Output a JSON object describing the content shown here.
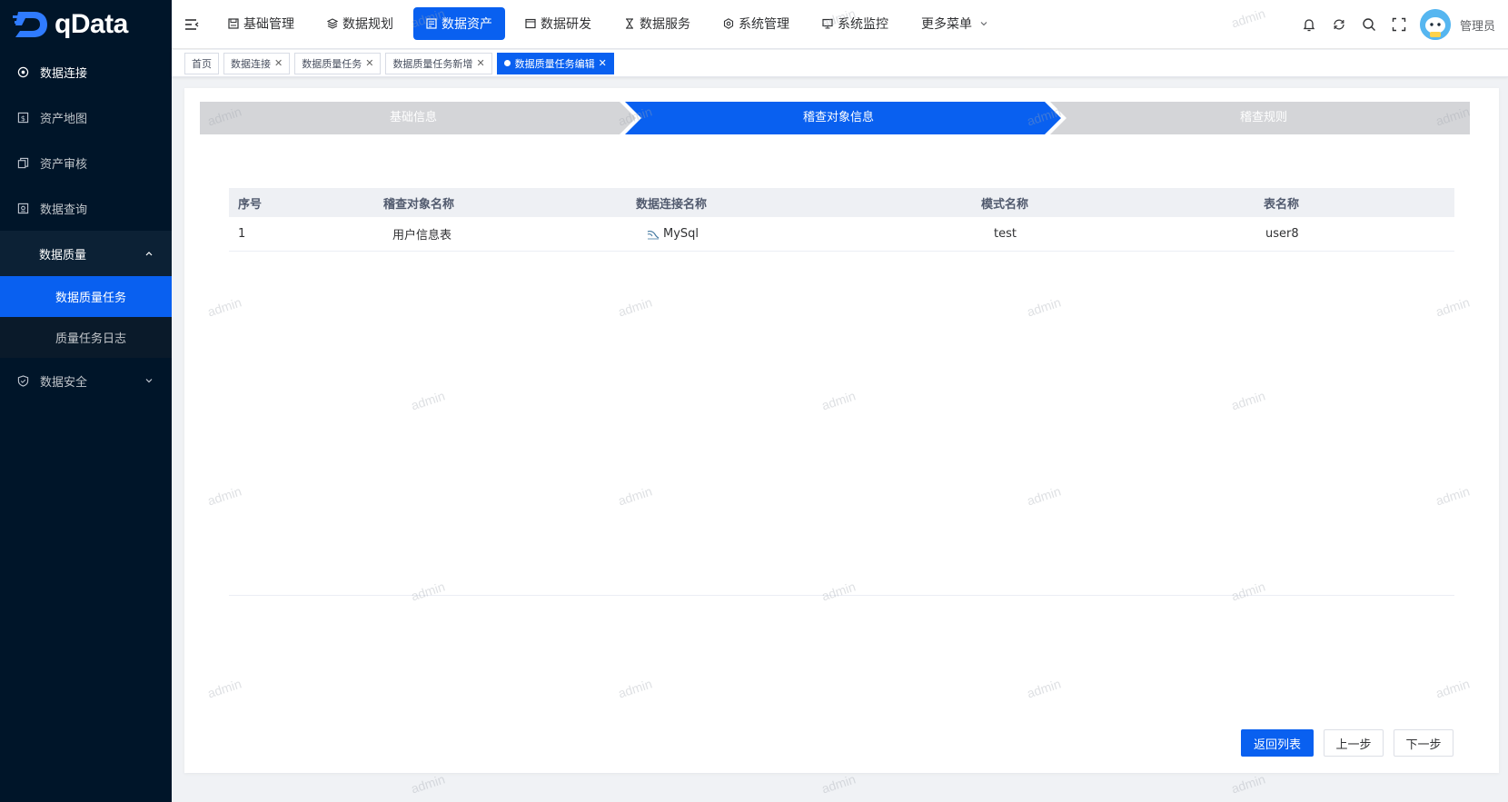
{
  "app": {
    "logo_text": "qData",
    "brand_color": "#0960f0"
  },
  "sidebar": {
    "items": [
      {
        "label": "数据连接",
        "icon": "target-icon"
      },
      {
        "label": "资产地图",
        "icon": "asset-map-icon"
      },
      {
        "label": "资产审核",
        "icon": "copy-icon"
      },
      {
        "label": "数据查询",
        "icon": "query-icon"
      },
      {
        "label": "数据质量",
        "icon": "",
        "expanded": true,
        "children": [
          {
            "label": "数据质量任务",
            "active": true
          },
          {
            "label": "质量任务日志"
          }
        ]
      },
      {
        "label": "数据安全",
        "icon": "shield-icon"
      }
    ]
  },
  "topnav": {
    "items": [
      {
        "label": "基础管理",
        "icon": "save-icon"
      },
      {
        "label": "数据规划",
        "icon": "layers-icon"
      },
      {
        "label": "数据资产",
        "icon": "asset-icon",
        "active": true
      },
      {
        "label": "数据研发",
        "icon": "window-icon"
      },
      {
        "label": "数据服务",
        "icon": "hourglass-icon"
      },
      {
        "label": "系统管理",
        "icon": "settings-icon"
      },
      {
        "label": "系统监控",
        "icon": "monitor-icon"
      },
      {
        "label": "更多菜单",
        "icon": "chevron-down-icon"
      }
    ],
    "user_name": "管理员"
  },
  "tags": [
    {
      "label": "首页",
      "closable": false
    },
    {
      "label": "数据连接",
      "closable": true
    },
    {
      "label": "数据质量任务",
      "closable": true
    },
    {
      "label": "数据质量任务新增",
      "closable": true
    },
    {
      "label": "数据质量任务编辑",
      "closable": true,
      "active": true
    }
  ],
  "steps": [
    {
      "label": "基础信息",
      "state": "done"
    },
    {
      "label": "稽查对象信息",
      "state": "active"
    },
    {
      "label": "稽查规则",
      "state": "pending"
    }
  ],
  "table": {
    "columns": [
      "序号",
      "稽查对象名称",
      "数据连接名称",
      "模式名称",
      "表名称"
    ],
    "rows": [
      {
        "index": "1",
        "name": "用户信息表",
        "connection": "MySql",
        "schema": "test",
        "table": "user8"
      }
    ]
  },
  "buttons": {
    "back": "返回列表",
    "prev": "上一步",
    "next": "下一步"
  },
  "watermark": "admin"
}
